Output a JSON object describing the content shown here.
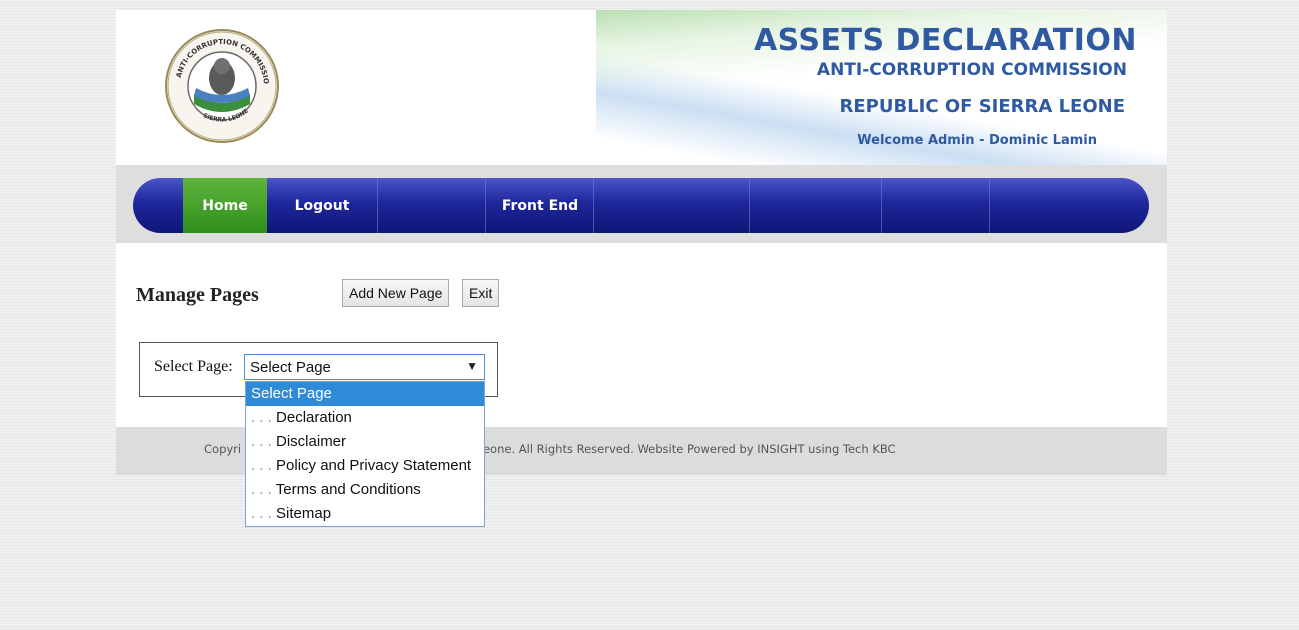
{
  "header": {
    "title": "ASSETS DECLARATION",
    "subtitle": "ANTI-CORRUPTION COMMISSION",
    "country": "REPUBLIC OF SIERRA LEONE",
    "welcome": "Welcome Admin - Dominic Lamin"
  },
  "logo": {
    "ring_text_top": "ANTI-CORRUPTION COMMISSION",
    "ring_text_bottom": "SIERRA LEONE"
  },
  "nav": {
    "items": [
      {
        "label": "Home",
        "active": true
      },
      {
        "label": "Logout",
        "active": false
      },
      {
        "label": "",
        "active": false
      },
      {
        "label": "Front End",
        "active": false
      },
      {
        "label": "",
        "active": false
      },
      {
        "label": "",
        "active": false
      },
      {
        "label": "",
        "active": false
      },
      {
        "label": "",
        "active": false
      }
    ]
  },
  "content": {
    "title": "Manage Pages",
    "add_button": "Add New Page",
    "exit_button": "Exit"
  },
  "select": {
    "label": "Select Page:",
    "value": "Select Page",
    "options": [
      {
        "label": "Select Page",
        "indent": ""
      },
      {
        "label": "Declaration",
        "indent": ". . . "
      },
      {
        "label": "Disclaimer",
        "indent": ". . . "
      },
      {
        "label": "Policy and Privacy Statement",
        "indent": ". . . "
      },
      {
        "label": "Terms and Conditions",
        "indent": ". . . "
      },
      {
        "label": "Sitemap",
        "indent": ". . . "
      }
    ]
  },
  "footer": {
    "text_left": "Copyri",
    "text_right": "n, Republic of Sierra Leone. All Rights Reserved. Website Powered by INSIGHT using Tech KBC"
  },
  "colors": {
    "brand_blue": "#2f5aa1",
    "nav_blue": "#1e279b",
    "nav_active_green": "#2f8e1b",
    "dropdown_highlight": "#2f8ad8"
  }
}
